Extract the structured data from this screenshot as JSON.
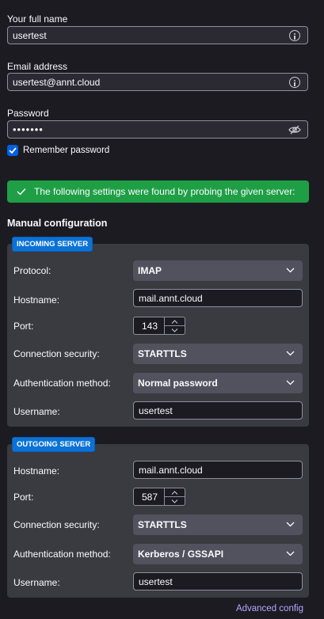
{
  "identity": {
    "name_label": "Your full name",
    "name_value": "usertest",
    "email_label": "Email address",
    "email_value": "usertest@annt.cloud",
    "password_label": "Password",
    "password_value": "•••••••",
    "remember_label": "Remember password",
    "remember_checked": true
  },
  "banner": {
    "text": "The following settings were found by probing the given server:",
    "color": "#1f9f45"
  },
  "manual": {
    "title": "Manual configuration",
    "incoming": {
      "badge": "INCOMING SERVER",
      "protocol_label": "Protocol:",
      "protocol_value": "IMAP",
      "hostname_label": "Hostname:",
      "hostname_value": "mail.annt.cloud",
      "port_label": "Port:",
      "port_value": "143",
      "security_label": "Connection security:",
      "security_value": "STARTTLS",
      "auth_label": "Authentication method:",
      "auth_value": "Normal password",
      "username_label": "Username:",
      "username_value": "usertest"
    },
    "outgoing": {
      "badge": "OUTGOING SERVER",
      "hostname_label": "Hostname:",
      "hostname_value": "mail.annt.cloud",
      "port_label": "Port:",
      "port_value": "587",
      "security_label": "Connection security:",
      "security_value": "STARTTLS",
      "auth_label": "Authentication method:",
      "auth_value": "Kerberos / GSSAPI",
      "username_label": "Username:",
      "username_value": "usertest"
    }
  },
  "advanced_link": "Advanced config",
  "colors": {
    "accent": "#0060df",
    "badge": "#0b72d6",
    "link": "#b8a6ff",
    "background": "#1c1b22"
  }
}
